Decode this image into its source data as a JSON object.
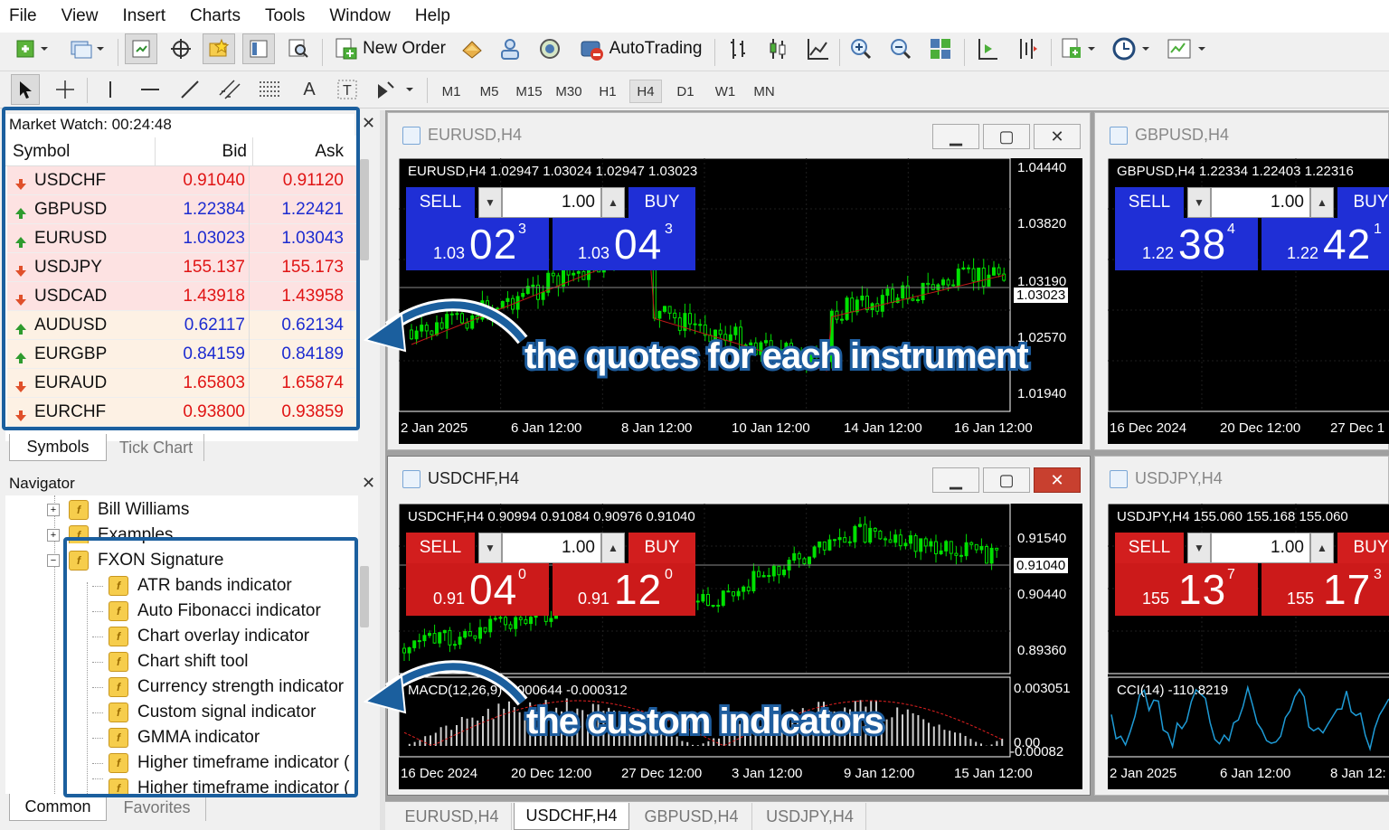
{
  "menu": [
    "File",
    "View",
    "Insert",
    "Charts",
    "Tools",
    "Window",
    "Help"
  ],
  "toolbar": {
    "new_order_label": "New Order",
    "autotrading_label": "AutoTrading",
    "timeframes": [
      "M1",
      "M5",
      "M15",
      "M30",
      "H1",
      "H4",
      "D1",
      "W1",
      "MN"
    ],
    "active_timeframe": "H4"
  },
  "market_watch": {
    "title": "Market Watch: 00:24:48",
    "columns": [
      "Symbol",
      "Bid",
      "Ask"
    ],
    "rows": [
      {
        "symbol": "USDCHF",
        "bid": "0.91040",
        "ask": "0.91120",
        "dir": "down"
      },
      {
        "symbol": "GBPUSD",
        "bid": "1.22384",
        "ask": "1.22421",
        "dir": "up"
      },
      {
        "symbol": "EURUSD",
        "bid": "1.03023",
        "ask": "1.03043",
        "dir": "up"
      },
      {
        "symbol": "USDJPY",
        "bid": "155.137",
        "ask": "155.173",
        "dir": "down"
      },
      {
        "symbol": "USDCAD",
        "bid": "1.43918",
        "ask": "1.43958",
        "dir": "down"
      },
      {
        "symbol": "AUDUSD",
        "bid": "0.62117",
        "ask": "0.62134",
        "dir": "up"
      },
      {
        "symbol": "EURGBP",
        "bid": "0.84159",
        "ask": "0.84189",
        "dir": "up"
      },
      {
        "symbol": "EURAUD",
        "bid": "1.65803",
        "ask": "1.65874",
        "dir": "down"
      },
      {
        "symbol": "EURCHF",
        "bid": "0.93800",
        "ask": "0.93859",
        "dir": "down"
      }
    ],
    "tabs": [
      "Symbols",
      "Tick Chart"
    ]
  },
  "navigator": {
    "title": "Navigator",
    "items": [
      "Bill Williams",
      "Examples",
      "FXON Signature"
    ],
    "indicators": [
      "ATR bands indicator",
      "Auto Fibonacci indicator",
      "Chart overlay indicator",
      "Chart shift tool",
      "Currency strength indicator",
      "Custom signal indicator",
      "GMMA indicator",
      "Higher timeframe indicator (",
      "Higher timeframe indicator ("
    ],
    "tabs": [
      "Common",
      "Favorites"
    ]
  },
  "charts": {
    "eurusd": {
      "title": "EURUSD,H4",
      "ohlc": "EURUSD,H4  1.02947 1.03024 1.02947 1.03023",
      "prices": [
        "1.04440",
        "1.03820",
        "1.03190",
        "1.03023",
        "1.02570",
        "1.01940"
      ],
      "times": [
        "2 Jan 2025",
        "6 Jan 12:00",
        "8 Jan 12:00",
        "10 Jan 12:00",
        "14 Jan 12:00",
        "16 Jan 12:00"
      ],
      "sell_label": "SELL",
      "buy_label": "BUY",
      "lot": "1.00",
      "sell": {
        "small": "1.03",
        "big": "02",
        "pip": "3"
      },
      "buy": {
        "small": "1.03",
        "big": "04",
        "pip": "3"
      }
    },
    "gbpusd": {
      "title": "GBPUSD,H4",
      "ohlc": "GBPUSD,H4  1.22334 1.22403 1.22316",
      "times": [
        "16 Dec 2024",
        "20 Dec 12:00",
        "27 Dec 1"
      ],
      "sell_label": "SELL",
      "buy_label": "BUY",
      "lot": "1.00",
      "sell": {
        "small": "1.22",
        "big": "38",
        "pip": "4"
      },
      "buy": {
        "small": "1.22",
        "big": "42",
        "pip": "1"
      }
    },
    "usdchf": {
      "title": "USDCHF,H4",
      "ohlc": "USDCHF,H4  0.90994 0.91084 0.90976 0.91040",
      "prices": [
        "0.91540",
        "0.91040",
        "0.90440",
        "0.89360"
      ],
      "macd_label": "MACD(12,26,9) 0.000644 -0.000312",
      "macd_prices": [
        "0.003051",
        "0.00",
        "-0.00082"
      ],
      "times": [
        "16 Dec 2024",
        "20 Dec 12:00",
        "27 Dec 12:00",
        "3 Jan 12:00",
        "9 Jan 12:00",
        "15 Jan 12:00"
      ],
      "sell_label": "SELL",
      "buy_label": "BUY",
      "lot": "1.00",
      "sell": {
        "small": "0.91",
        "big": "04",
        "pip": "0"
      },
      "buy": {
        "small": "0.91",
        "big": "12",
        "pip": "0"
      }
    },
    "usdjpy": {
      "title": "USDJPY,H4",
      "ohlc": "USDJPY,H4  155.060 155.168 155.060",
      "cci_label": "CCI(14) -110.8219",
      "times": [
        "2 Jan 2025",
        "6 Jan 12:00",
        "8 Jan 12:"
      ],
      "sell_label": "SELL",
      "buy_label": "BUY",
      "lot": "1.00",
      "sell": {
        "small": "155",
        "big": "13",
        "pip": "7"
      },
      "buy": {
        "small": "155",
        "big": "17",
        "pip": "3"
      }
    }
  },
  "bottom_tabs": [
    "EURUSD,H4",
    "USDCHF,H4",
    "GBPUSD,H4",
    "USDJPY,H4"
  ],
  "active_bottom_tab": "USDCHF,H4",
  "callouts": {
    "quotes": "the quotes for each instrument",
    "indicators": "the custom indicators"
  },
  "colors": {
    "accent": "#1b5f9e",
    "sell_blue": "#1a24c8",
    "sell_red": "#cc1a1a",
    "candle_green": "#00e000"
  }
}
